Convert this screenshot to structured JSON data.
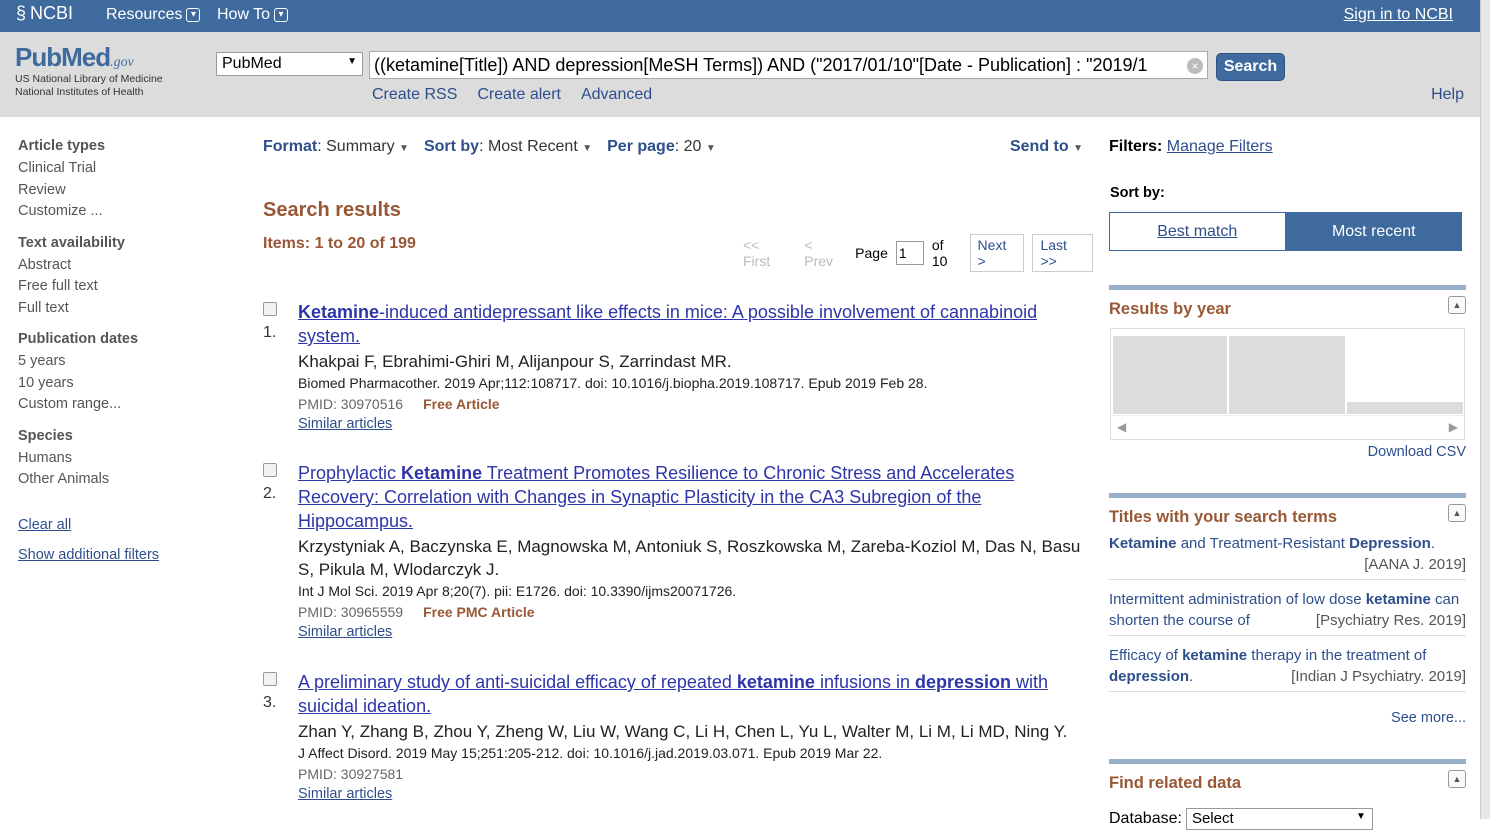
{
  "topbar": {
    "brand": "NCBI",
    "menus": [
      "Resources",
      "How To"
    ],
    "signin": "Sign in to NCBI"
  },
  "logo": {
    "name": "PubMed",
    "gov": ".gov",
    "org1": "US National Library of Medicine",
    "org2": "National Institutes of Health"
  },
  "search": {
    "database": "PubMed",
    "term": "((ketamine[Title]) AND depression[MeSH Terms]) AND (\"2017/01/10\"[Date - Publication] : \"2019/1",
    "button": "Search",
    "links": [
      "Create RSS",
      "Create alert",
      "Advanced"
    ],
    "help": "Help"
  },
  "filters": {
    "groups": [
      {
        "heading": "Article types",
        "items": [
          "Clinical Trial",
          "Review",
          "Customize ..."
        ]
      },
      {
        "heading": "Text availability",
        "items": [
          "Abstract",
          "Free full text",
          "Full text"
        ]
      },
      {
        "heading": "Publication dates",
        "items": [
          "5 years",
          "10 years",
          "Custom range..."
        ]
      },
      {
        "heading": "Species",
        "items": [
          "Humans",
          "Other Animals"
        ]
      }
    ],
    "clear_all": "Clear all",
    "show_additional": "Show additional filters"
  },
  "toolbar": {
    "format_label": "Format",
    "format_value": "Summary",
    "sort_label": "Sort by",
    "sort_value": "Most Recent",
    "perpage_label": "Per page",
    "perpage_value": "20",
    "send_to": "Send to"
  },
  "results_header": {
    "title": "Search results",
    "items": "Items: 1 to 20 of 199"
  },
  "pager": {
    "first": "<< First",
    "prev": "< Prev",
    "page_label": "Page",
    "page": "1",
    "of": "of 10",
    "next": "Next >",
    "last": "Last >>"
  },
  "results": [
    {
      "num": "1.",
      "title_parts": [
        [
          "Ketamine",
          true
        ],
        [
          "-induced antidepressant like effects in mice: A possible involvement of cannabinoid system.",
          false
        ]
      ],
      "authors": "Khakpai F, Ebrahimi-Ghiri M, Alijanpour S, Zarrindast MR.",
      "citation": "Biomed Pharmacother. 2019 Apr;112:108717. doi: 10.1016/j.biopha.2019.108717. Epub 2019 Feb 28.",
      "pmid": "PMID: 30970516",
      "free": "Free Article",
      "similar": "Similar articles"
    },
    {
      "num": "2.",
      "title_parts": [
        [
          "Prophylactic ",
          false
        ],
        [
          "Ketamine",
          true
        ],
        [
          " Treatment Promotes Resilience to Chronic Stress and Accelerates Recovery: Correlation with Changes in Synaptic Plasticity in the CA3 Subregion of the Hippocampus.",
          false
        ]
      ],
      "authors": "Krzystyniak A, Baczynska E, Magnowska M, Antoniuk S, Roszkowska M, Zareba-Koziol M, Das N, Basu S, Pikula M, Wlodarczyk J.",
      "citation": "Int J Mol Sci. 2019 Apr 8;20(7). pii: E1726. doi: 10.3390/ijms20071726.",
      "pmid": "PMID: 30965559",
      "free": "Free PMC Article",
      "similar": "Similar articles"
    },
    {
      "num": "3.",
      "title_parts": [
        [
          "A preliminary study of anti-suicidal efficacy of repeated ",
          false
        ],
        [
          "ketamine",
          true
        ],
        [
          " infusions in ",
          false
        ],
        [
          "depression",
          true
        ],
        [
          " with suicidal ideation.",
          false
        ]
      ],
      "authors": "Zhan Y, Zhang B, Zhou Y, Zheng W, Liu W, Wang C, Li H, Chen L, Yu L, Walter M, Li M, Li MD, Ning Y.",
      "citation": "J Affect Disord. 2019 May 15;251:205-212. doi: 10.1016/j.jad.2019.03.071. Epub 2019 Mar 22.",
      "pmid": "PMID: 30927581",
      "free": "",
      "similar": "Similar articles"
    }
  ],
  "sidebar": {
    "filters_label": "Filters:",
    "manage_filters": "Manage Filters",
    "sort_by": "Sort by:",
    "best_match": "Best match",
    "most_recent": "Most recent",
    "results_by_year": "Results by year",
    "year_levels": [
      0.95,
      0.95,
      0.15
    ],
    "download_csv": "Download CSV",
    "titles_heading": "Titles with your search terms",
    "titles": [
      {
        "parts": [
          [
            "Ketamine",
            true
          ],
          [
            " and Treatment-Resistant ",
            false
          ],
          [
            "Depression",
            true
          ],
          [
            ".",
            false
          ]
        ],
        "source": "[AANA J. 2019]"
      },
      {
        "parts": [
          [
            "Intermittent administration of low dose ",
            false
          ],
          [
            "ketamine",
            true
          ],
          [
            " can shorten the course of",
            false
          ]
        ],
        "source": "[Psychiatry Res. 2019]"
      },
      {
        "parts": [
          [
            "Efficacy of ",
            false
          ],
          [
            "ketamine",
            true
          ],
          [
            " therapy in the treatment of ",
            false
          ],
          [
            "depression",
            true
          ],
          [
            ".",
            false
          ]
        ],
        "source": "[Indian J Psychiatry. 2019]"
      }
    ],
    "see_more": "See more...",
    "find_related": "Find related data",
    "database_label": "Database:",
    "database_value": "Select"
  }
}
